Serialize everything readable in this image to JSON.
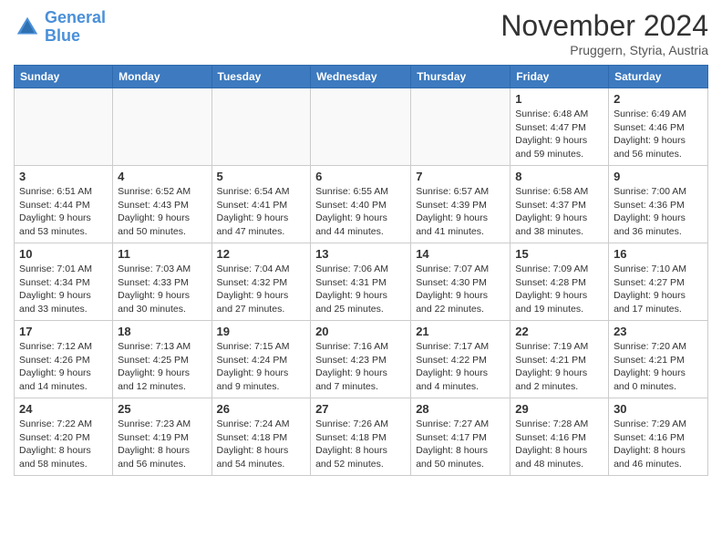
{
  "header": {
    "logo_line1": "General",
    "logo_line2": "Blue",
    "month": "November 2024",
    "location": "Pruggern, Styria, Austria"
  },
  "weekdays": [
    "Sunday",
    "Monday",
    "Tuesday",
    "Wednesday",
    "Thursday",
    "Friday",
    "Saturday"
  ],
  "weeks": [
    [
      {
        "day": "",
        "info": ""
      },
      {
        "day": "",
        "info": ""
      },
      {
        "day": "",
        "info": ""
      },
      {
        "day": "",
        "info": ""
      },
      {
        "day": "",
        "info": ""
      },
      {
        "day": "1",
        "info": "Sunrise: 6:48 AM\nSunset: 4:47 PM\nDaylight: 9 hours and 59 minutes."
      },
      {
        "day": "2",
        "info": "Sunrise: 6:49 AM\nSunset: 4:46 PM\nDaylight: 9 hours and 56 minutes."
      }
    ],
    [
      {
        "day": "3",
        "info": "Sunrise: 6:51 AM\nSunset: 4:44 PM\nDaylight: 9 hours and 53 minutes."
      },
      {
        "day": "4",
        "info": "Sunrise: 6:52 AM\nSunset: 4:43 PM\nDaylight: 9 hours and 50 minutes."
      },
      {
        "day": "5",
        "info": "Sunrise: 6:54 AM\nSunset: 4:41 PM\nDaylight: 9 hours and 47 minutes."
      },
      {
        "day": "6",
        "info": "Sunrise: 6:55 AM\nSunset: 4:40 PM\nDaylight: 9 hours and 44 minutes."
      },
      {
        "day": "7",
        "info": "Sunrise: 6:57 AM\nSunset: 4:39 PM\nDaylight: 9 hours and 41 minutes."
      },
      {
        "day": "8",
        "info": "Sunrise: 6:58 AM\nSunset: 4:37 PM\nDaylight: 9 hours and 38 minutes."
      },
      {
        "day": "9",
        "info": "Sunrise: 7:00 AM\nSunset: 4:36 PM\nDaylight: 9 hours and 36 minutes."
      }
    ],
    [
      {
        "day": "10",
        "info": "Sunrise: 7:01 AM\nSunset: 4:34 PM\nDaylight: 9 hours and 33 minutes."
      },
      {
        "day": "11",
        "info": "Sunrise: 7:03 AM\nSunset: 4:33 PM\nDaylight: 9 hours and 30 minutes."
      },
      {
        "day": "12",
        "info": "Sunrise: 7:04 AM\nSunset: 4:32 PM\nDaylight: 9 hours and 27 minutes."
      },
      {
        "day": "13",
        "info": "Sunrise: 7:06 AM\nSunset: 4:31 PM\nDaylight: 9 hours and 25 minutes."
      },
      {
        "day": "14",
        "info": "Sunrise: 7:07 AM\nSunset: 4:30 PM\nDaylight: 9 hours and 22 minutes."
      },
      {
        "day": "15",
        "info": "Sunrise: 7:09 AM\nSunset: 4:28 PM\nDaylight: 9 hours and 19 minutes."
      },
      {
        "day": "16",
        "info": "Sunrise: 7:10 AM\nSunset: 4:27 PM\nDaylight: 9 hours and 17 minutes."
      }
    ],
    [
      {
        "day": "17",
        "info": "Sunrise: 7:12 AM\nSunset: 4:26 PM\nDaylight: 9 hours and 14 minutes."
      },
      {
        "day": "18",
        "info": "Sunrise: 7:13 AM\nSunset: 4:25 PM\nDaylight: 9 hours and 12 minutes."
      },
      {
        "day": "19",
        "info": "Sunrise: 7:15 AM\nSunset: 4:24 PM\nDaylight: 9 hours and 9 minutes."
      },
      {
        "day": "20",
        "info": "Sunrise: 7:16 AM\nSunset: 4:23 PM\nDaylight: 9 hours and 7 minutes."
      },
      {
        "day": "21",
        "info": "Sunrise: 7:17 AM\nSunset: 4:22 PM\nDaylight: 9 hours and 4 minutes."
      },
      {
        "day": "22",
        "info": "Sunrise: 7:19 AM\nSunset: 4:21 PM\nDaylight: 9 hours and 2 minutes."
      },
      {
        "day": "23",
        "info": "Sunrise: 7:20 AM\nSunset: 4:21 PM\nDaylight: 9 hours and 0 minutes."
      }
    ],
    [
      {
        "day": "24",
        "info": "Sunrise: 7:22 AM\nSunset: 4:20 PM\nDaylight: 8 hours and 58 minutes."
      },
      {
        "day": "25",
        "info": "Sunrise: 7:23 AM\nSunset: 4:19 PM\nDaylight: 8 hours and 56 minutes."
      },
      {
        "day": "26",
        "info": "Sunrise: 7:24 AM\nSunset: 4:18 PM\nDaylight: 8 hours and 54 minutes."
      },
      {
        "day": "27",
        "info": "Sunrise: 7:26 AM\nSunset: 4:18 PM\nDaylight: 8 hours and 52 minutes."
      },
      {
        "day": "28",
        "info": "Sunrise: 7:27 AM\nSunset: 4:17 PM\nDaylight: 8 hours and 50 minutes."
      },
      {
        "day": "29",
        "info": "Sunrise: 7:28 AM\nSunset: 4:16 PM\nDaylight: 8 hours and 48 minutes."
      },
      {
        "day": "30",
        "info": "Sunrise: 7:29 AM\nSunset: 4:16 PM\nDaylight: 8 hours and 46 minutes."
      }
    ]
  ]
}
